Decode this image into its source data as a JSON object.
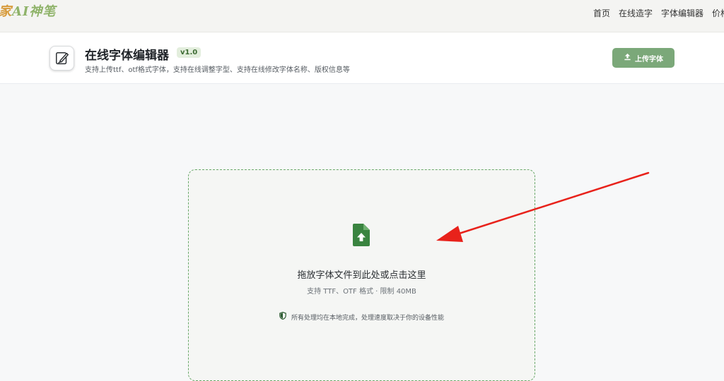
{
  "brand": {
    "part1": "家",
    "part2": "AI神笔",
    "accent1": "#d79a3a",
    "accent2": "#8fb36a"
  },
  "topnav": {
    "items": [
      {
        "label": "首页"
      },
      {
        "label": "在线造字"
      },
      {
        "label": "字体编辑器"
      },
      {
        "label": "价格"
      }
    ]
  },
  "header": {
    "icon": "pen-edit-icon",
    "title": "在线字体编辑器",
    "version": "v1.0",
    "subtitle": "支持上传ttf、otf格式字体，支持在线调整字型、支持在线修改字体名称、版权信息等",
    "upload_button": {
      "icon": "upload-icon",
      "label": "上传字体"
    },
    "accent_color": "#7ba879"
  },
  "dropzone": {
    "icon": "file-upload-icon",
    "title": "拖放字体文件到此处或点击这里",
    "hint": "支持 TTF、OTF 格式 · 限制 40MB",
    "privacy_icon": "shield-icon",
    "privacy_text": "所有处理均在本地完成，处理速度取决于你的设备性能",
    "border_color": "#6aa86a"
  },
  "annotation": {
    "type": "red-arrow",
    "color": "#e8221b"
  }
}
